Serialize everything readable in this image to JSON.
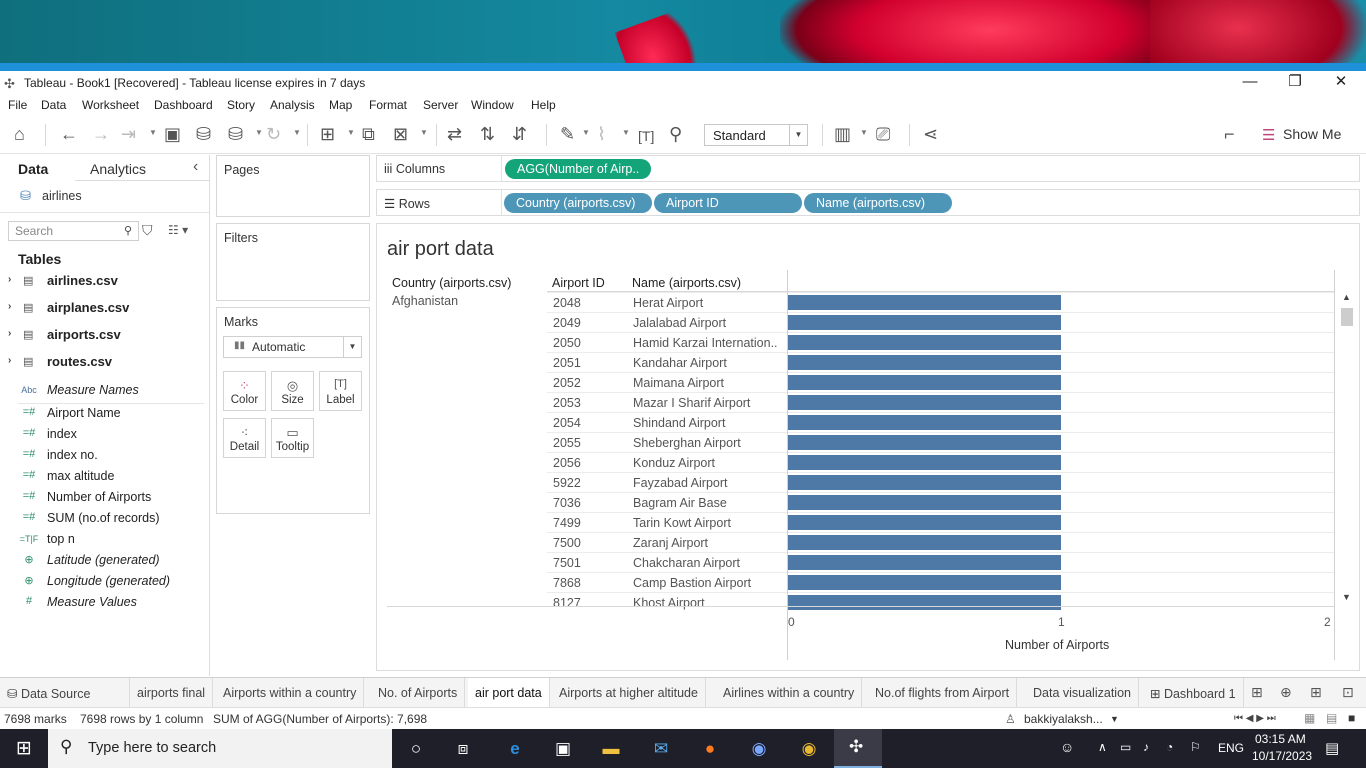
{
  "window": {
    "title": "Tableau - Book1 [Recovered] - Tableau license expires in 7 days",
    "minimize": "—",
    "restore": "❐",
    "close": "✕"
  },
  "menu": [
    "File",
    "Data",
    "Worksheet",
    "Dashboard",
    "Story",
    "Analysis",
    "Map",
    "Format",
    "Server",
    "Window",
    "Help"
  ],
  "toolbar": {
    "fit": "Standard",
    "show_me": "Show Me"
  },
  "data_pane": {
    "tabs": [
      "Data",
      "Analytics"
    ],
    "collapse": "‹",
    "datasource": "airlines",
    "search_placeholder": "Search",
    "tables_heading": "Tables",
    "tables": [
      "airlines.csv",
      "airplanes.csv",
      "airports.csv",
      "routes.csv"
    ],
    "fields": [
      {
        "name": "Measure Names",
        "icon": "Abc",
        "italic": true
      },
      {
        "name": "Airport Name",
        "icon": "=#",
        "italic": false
      },
      {
        "name": "index",
        "icon": "=#",
        "italic": false
      },
      {
        "name": "index no.",
        "icon": "=#",
        "italic": false
      },
      {
        "name": "max altitude",
        "icon": "=#",
        "italic": false
      },
      {
        "name": "Number of Airports",
        "icon": "=#",
        "italic": false
      },
      {
        "name": "SUM (no.of records)",
        "icon": "=#",
        "italic": false
      },
      {
        "name": "top n",
        "icon": "=T|F",
        "italic": false
      },
      {
        "name": "Latitude (generated)",
        "icon": "globe",
        "italic": true
      },
      {
        "name": "Longitude (generated)",
        "icon": "globe",
        "italic": true
      },
      {
        "name": "Measure Values",
        "icon": "#",
        "italic": true
      }
    ]
  },
  "cards": {
    "pages": "Pages",
    "filters": "Filters",
    "marks": "Marks",
    "marks_type": "Automatic",
    "mark_buttons": [
      "Color",
      "Size",
      "Label",
      "Detail",
      "Tooltip"
    ]
  },
  "shelves": {
    "columns_label": "Columns",
    "rows_label": "Rows",
    "columns": [
      "AGG(Number of Airp.."
    ],
    "rows": [
      "Country (airports.csv)",
      "Airport ID",
      "Name (airports.csv)"
    ]
  },
  "view": {
    "sheet_title": "air port data",
    "headers": {
      "country": "Country (airports.csv)",
      "airport_id": "Airport ID",
      "name": "Name (airports.csv)"
    },
    "country": "Afghanistan",
    "x_axis_label": "Number of Airports",
    "x_ticks": [
      "0",
      "1",
      "2"
    ]
  },
  "chart_data": {
    "type": "bar",
    "orientation": "horizontal",
    "title": "air port data",
    "xlabel": "Number of Airports",
    "xlim": [
      0,
      2
    ],
    "categories": [
      "2048",
      "2049",
      "2050",
      "2051",
      "2052",
      "2053",
      "2054",
      "2055",
      "2056",
      "5922",
      "7036",
      "7499",
      "7500",
      "7501",
      "7868",
      "8127"
    ],
    "labels": [
      "Herat Airport",
      "Jalalabad Airport",
      "Hamid Karzai Internation..",
      "Kandahar Airport",
      "Maimana Airport",
      "Mazar I Sharif Airport",
      "Shindand Airport",
      "Sheberghan Airport",
      "Konduz Airport",
      "Fayzabad Airport",
      "Bagram Air Base",
      "Tarin Kowt Airport",
      "Zaranj Airport",
      "Chakcharan Airport",
      "Camp Bastion Airport",
      "Khost Airport"
    ],
    "values": [
      1,
      1,
      1,
      1,
      1,
      1,
      1,
      1,
      1,
      1,
      1,
      1,
      1,
      1,
      1,
      1
    ],
    "color": "#4e79a7"
  },
  "sheet_tabs": [
    "Data Source",
    "airports final",
    "Airports within a country",
    "No. of Airports",
    "air port data",
    "Airports at higher altitude",
    "Airlines within a country",
    "No.of flights from Airport",
    "Data visualization",
    "Dashboard 1"
  ],
  "active_tab": "air port data",
  "status": {
    "marks": "7698 marks",
    "rows": "7698 rows by 1 column",
    "sum": "SUM of AGG(Number of Airports): 7,698",
    "user": "bakkiyalaksh..."
  },
  "taskbar": {
    "search_placeholder": "Type here to search",
    "lang": "ENG",
    "time": "03:15 AM",
    "date": "10/17/2023"
  }
}
